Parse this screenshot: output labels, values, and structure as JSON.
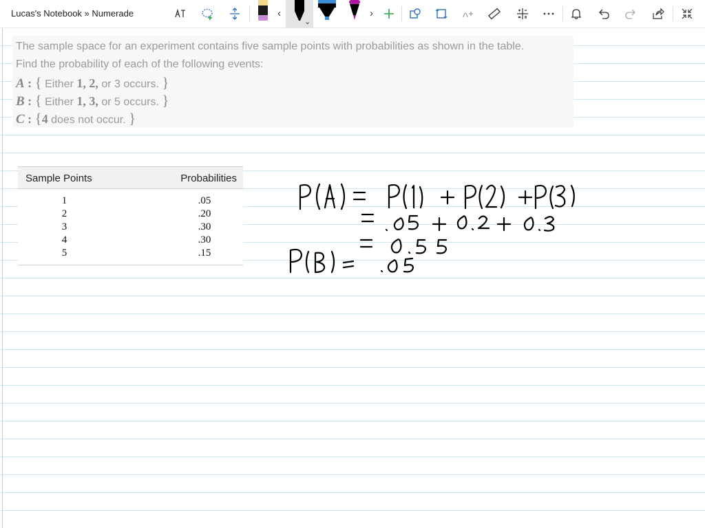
{
  "app": {
    "title": "Lucas's Notebook » Numerade"
  },
  "toolbar": {
    "buttons": [
      {
        "name": "ink-to-text",
        "icon": "ink-to-text-icon"
      },
      {
        "name": "lasso-select",
        "icon": "lasso-select-icon"
      },
      {
        "name": "add-space",
        "icon": "add-space-icon"
      },
      {
        "name": "pen-yellow-black",
        "icon": "pen-icon"
      },
      {
        "name": "pen-black",
        "icon": "pen-icon"
      },
      {
        "name": "highlighter-blue",
        "icon": "highlighter-icon"
      },
      {
        "name": "pen-magenta",
        "icon": "pen-icon"
      },
      {
        "name": "add-pen",
        "icon": "plus-icon"
      },
      {
        "name": "shapes",
        "icon": "shapes-icon"
      },
      {
        "name": "ink-to-shape",
        "icon": "ink-to-shape-icon"
      },
      {
        "name": "ink-to-math",
        "icon": "ink-to-math-icon"
      },
      {
        "name": "ruler",
        "icon": "ruler-icon"
      },
      {
        "name": "math",
        "icon": "math-icon"
      },
      {
        "name": "more",
        "icon": "more-icon"
      },
      {
        "name": "notifications",
        "icon": "bell-icon"
      },
      {
        "name": "undo",
        "icon": "undo-icon"
      },
      {
        "name": "redo",
        "icon": "redo-icon"
      },
      {
        "name": "share",
        "icon": "share-icon"
      },
      {
        "name": "full-screen",
        "icon": "collapse-icon"
      }
    ],
    "pen_colors": {
      "pen1_body": "#1a1a1a",
      "pen1_cap": "#f5d98b",
      "pen1_tip": "#c58bd6",
      "pen2_body": "#000000",
      "highlighter": "#3b8fd9",
      "pen3": "#b0179f",
      "accent_green": "#2aa745",
      "icon_blue": "#2b6fc2"
    }
  },
  "problem": {
    "line1": "The sample space for an experiment contains five sample points with probabilities as shown in the table.",
    "line2": "Find the probability of each of the following events:",
    "events": [
      {
        "var": "A",
        "colon": ":",
        "open": "{",
        "text_before": " Either ",
        "math": "1, 2,",
        "text_after": " or 3 occurs. ",
        "close": "}"
      },
      {
        "var": "B",
        "colon": ":",
        "open": "{",
        "text_before": " Either ",
        "math": "1, 3,",
        "text_after": " or 5 occurs. ",
        "close": "}"
      },
      {
        "var": "C",
        "colon": ":",
        "open": "{",
        "text_before": "",
        "math": "4",
        "text_after": " does not occur. ",
        "close": "}"
      }
    ]
  },
  "table": {
    "headers": [
      "Sample Points",
      "Probabilities"
    ],
    "rows": [
      [
        "1",
        ".05"
      ],
      [
        "2",
        ".20"
      ],
      [
        "3",
        ".30"
      ],
      [
        "4",
        ".30"
      ],
      [
        "5",
        ".15"
      ]
    ]
  },
  "handwriting": {
    "lines": [
      "P(A) = P(1) + P(2) + P(3)",
      "= .05 + 0.2 + 0.3",
      "= 0.55",
      "P(B) = .05"
    ]
  }
}
